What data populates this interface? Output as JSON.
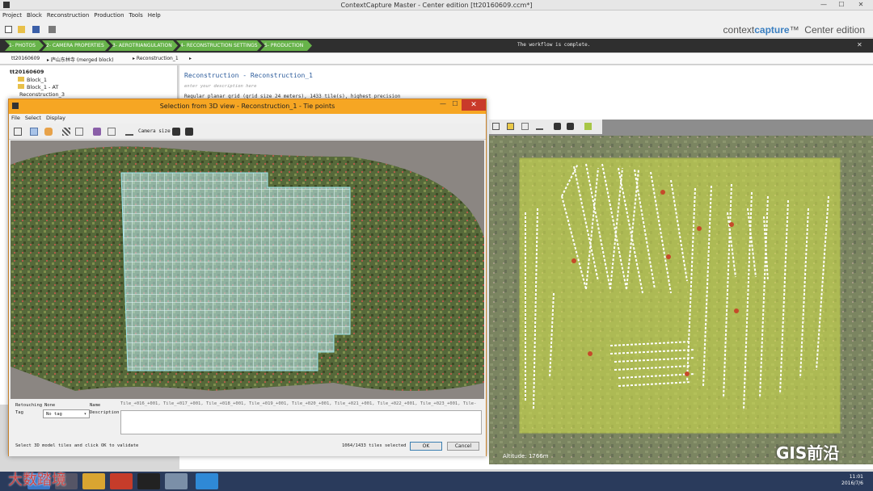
{
  "window": {
    "title": "ContextCapture Master - Center edition [tt20160609.ccm*]",
    "minimize": "—",
    "maximize": "☐",
    "close": "✕"
  },
  "menu": [
    "Project",
    "Block",
    "Reconstruction",
    "Production",
    "Tools",
    "Help"
  ],
  "brand": {
    "a": "context",
    "b": "capture",
    "tm": "™",
    "edition": "Center edition"
  },
  "steps": [
    "1- PHOTOS",
    "2- CAMERA PROPERTIES",
    "3- AEROTRIANGULATION",
    "4- RECONSTRUCTION SETTINGS",
    "5- PRODUCTION"
  ],
  "workflow_status": "The workflow is complete.",
  "breadcrumb": [
    "tt20160609",
    "▸ 庐山东林寺 (merged block)",
    "▸ Reconstruction_1",
    "▸"
  ],
  "tree": {
    "root": "tt20160609",
    "items": [
      "Block_1",
      "Block_1 - AT",
      "Reconstruction_3"
    ]
  },
  "reconstruction": {
    "title": "Reconstruction - Reconstruction_1",
    "description_placeholder": "enter your description here",
    "summary": "Regular planar grid (grid size 24 meters), 1433 tile(s), highest precision"
  },
  "dialog": {
    "title": "Selection from 3D view - Reconstruction_1 - Tie points",
    "menu": [
      "File",
      "Select",
      "Display"
    ],
    "camera_size_label": "Camera size",
    "retouching_label": "Retouching",
    "retouching_value": "None",
    "name_label": "Name",
    "tag_label": "Tag",
    "tag_value": "No tag",
    "description_label": "Description",
    "tiles_list": "Tile_+016_+001, Tile_+017_+001, Tile_+018_+001, Tile_+019_+001, Tile_+020_+001, Tile_+021_+001, Tile_+022_+001, Tile_+023_+001, Tile-",
    "hint": "Select 3D model tiles and click OK to validate",
    "status": "1064/1433 tiles selected",
    "ok": "OK",
    "cancel": "Cancel"
  },
  "right_view": {
    "altitude": "Altitude: 1766m"
  },
  "taskbar": {
    "time": "11:01",
    "date": "2016/7/6"
  },
  "watermarks": {
    "right": "GIS前沿",
    "left": "大数踏境"
  },
  "colors": {
    "step_green": "#67b34a",
    "dialog_orange": "#f6a623",
    "grid_cyan": "#9fe8f0",
    "footprint_yellow": "#d7e64a"
  }
}
